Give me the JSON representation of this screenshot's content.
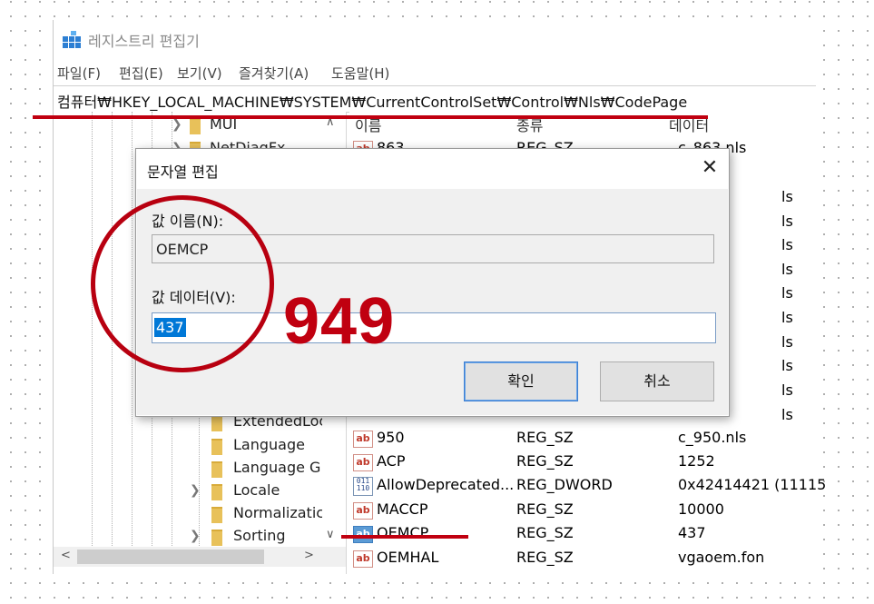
{
  "window": {
    "title": "레지스트리 편집기",
    "menu": [
      "파일(F)",
      "편집(E)",
      "보기(V)",
      "즐겨찾기(A)",
      "도움말(H)"
    ],
    "address": "컴퓨터₩HKEY_LOCAL_MACHINE₩SYSTEM₩CurrentControlSet₩Control₩Nls₩CodePage"
  },
  "tree": {
    "items": [
      {
        "label": "MUI",
        "expander": true
      },
      {
        "label": "NetDiagFx",
        "expander": true
      },
      {
        "label": "ExtendedLoc",
        "expander": false
      },
      {
        "label": "Language",
        "expander": false
      },
      {
        "label": "Language G",
        "expander": false
      },
      {
        "label": "Locale",
        "expander": true
      },
      {
        "label": "Normalizatic",
        "expander": false
      },
      {
        "label": "Sorting",
        "expander": true
      }
    ]
  },
  "list": {
    "headers": {
      "name": "이름",
      "type": "종류",
      "data": "데이터"
    },
    "partial_rows": [
      {
        "name": "863",
        "type": "REG_SZ",
        "data": "c_863.nls"
      }
    ],
    "partial_data_suffix": "ls",
    "rows": [
      {
        "icon": "ab",
        "name": "950",
        "type": "REG_SZ",
        "data": "c_950.nls"
      },
      {
        "icon": "ab",
        "name": "ACP",
        "type": "REG_SZ",
        "data": "1252"
      },
      {
        "icon": "bin",
        "name": "AllowDeprecated...",
        "type": "REG_DWORD",
        "data": "0x42414421 (11115"
      },
      {
        "icon": "ab",
        "name": "MACCP",
        "type": "REG_SZ",
        "data": "10000"
      },
      {
        "icon": "ab",
        "name": "OEMCP",
        "type": "REG_SZ",
        "data": "437"
      },
      {
        "icon": "ab",
        "name": "OEMHAL",
        "type": "REG_SZ",
        "data": "vgaoem.fon"
      }
    ]
  },
  "dialog": {
    "title": "문자열 편집",
    "name_label": "값 이름(N):",
    "name_value": "OEMCP",
    "data_label": "값 데이터(V):",
    "data_value": "437",
    "ok_label": "확인",
    "cancel_label": "취소"
  },
  "annotation": {
    "text": "949",
    "color": "#c00010"
  },
  "colors": {
    "selection": "#0078d7",
    "dialog_bg": "#f0f0f0",
    "annotation": "#c00010"
  }
}
